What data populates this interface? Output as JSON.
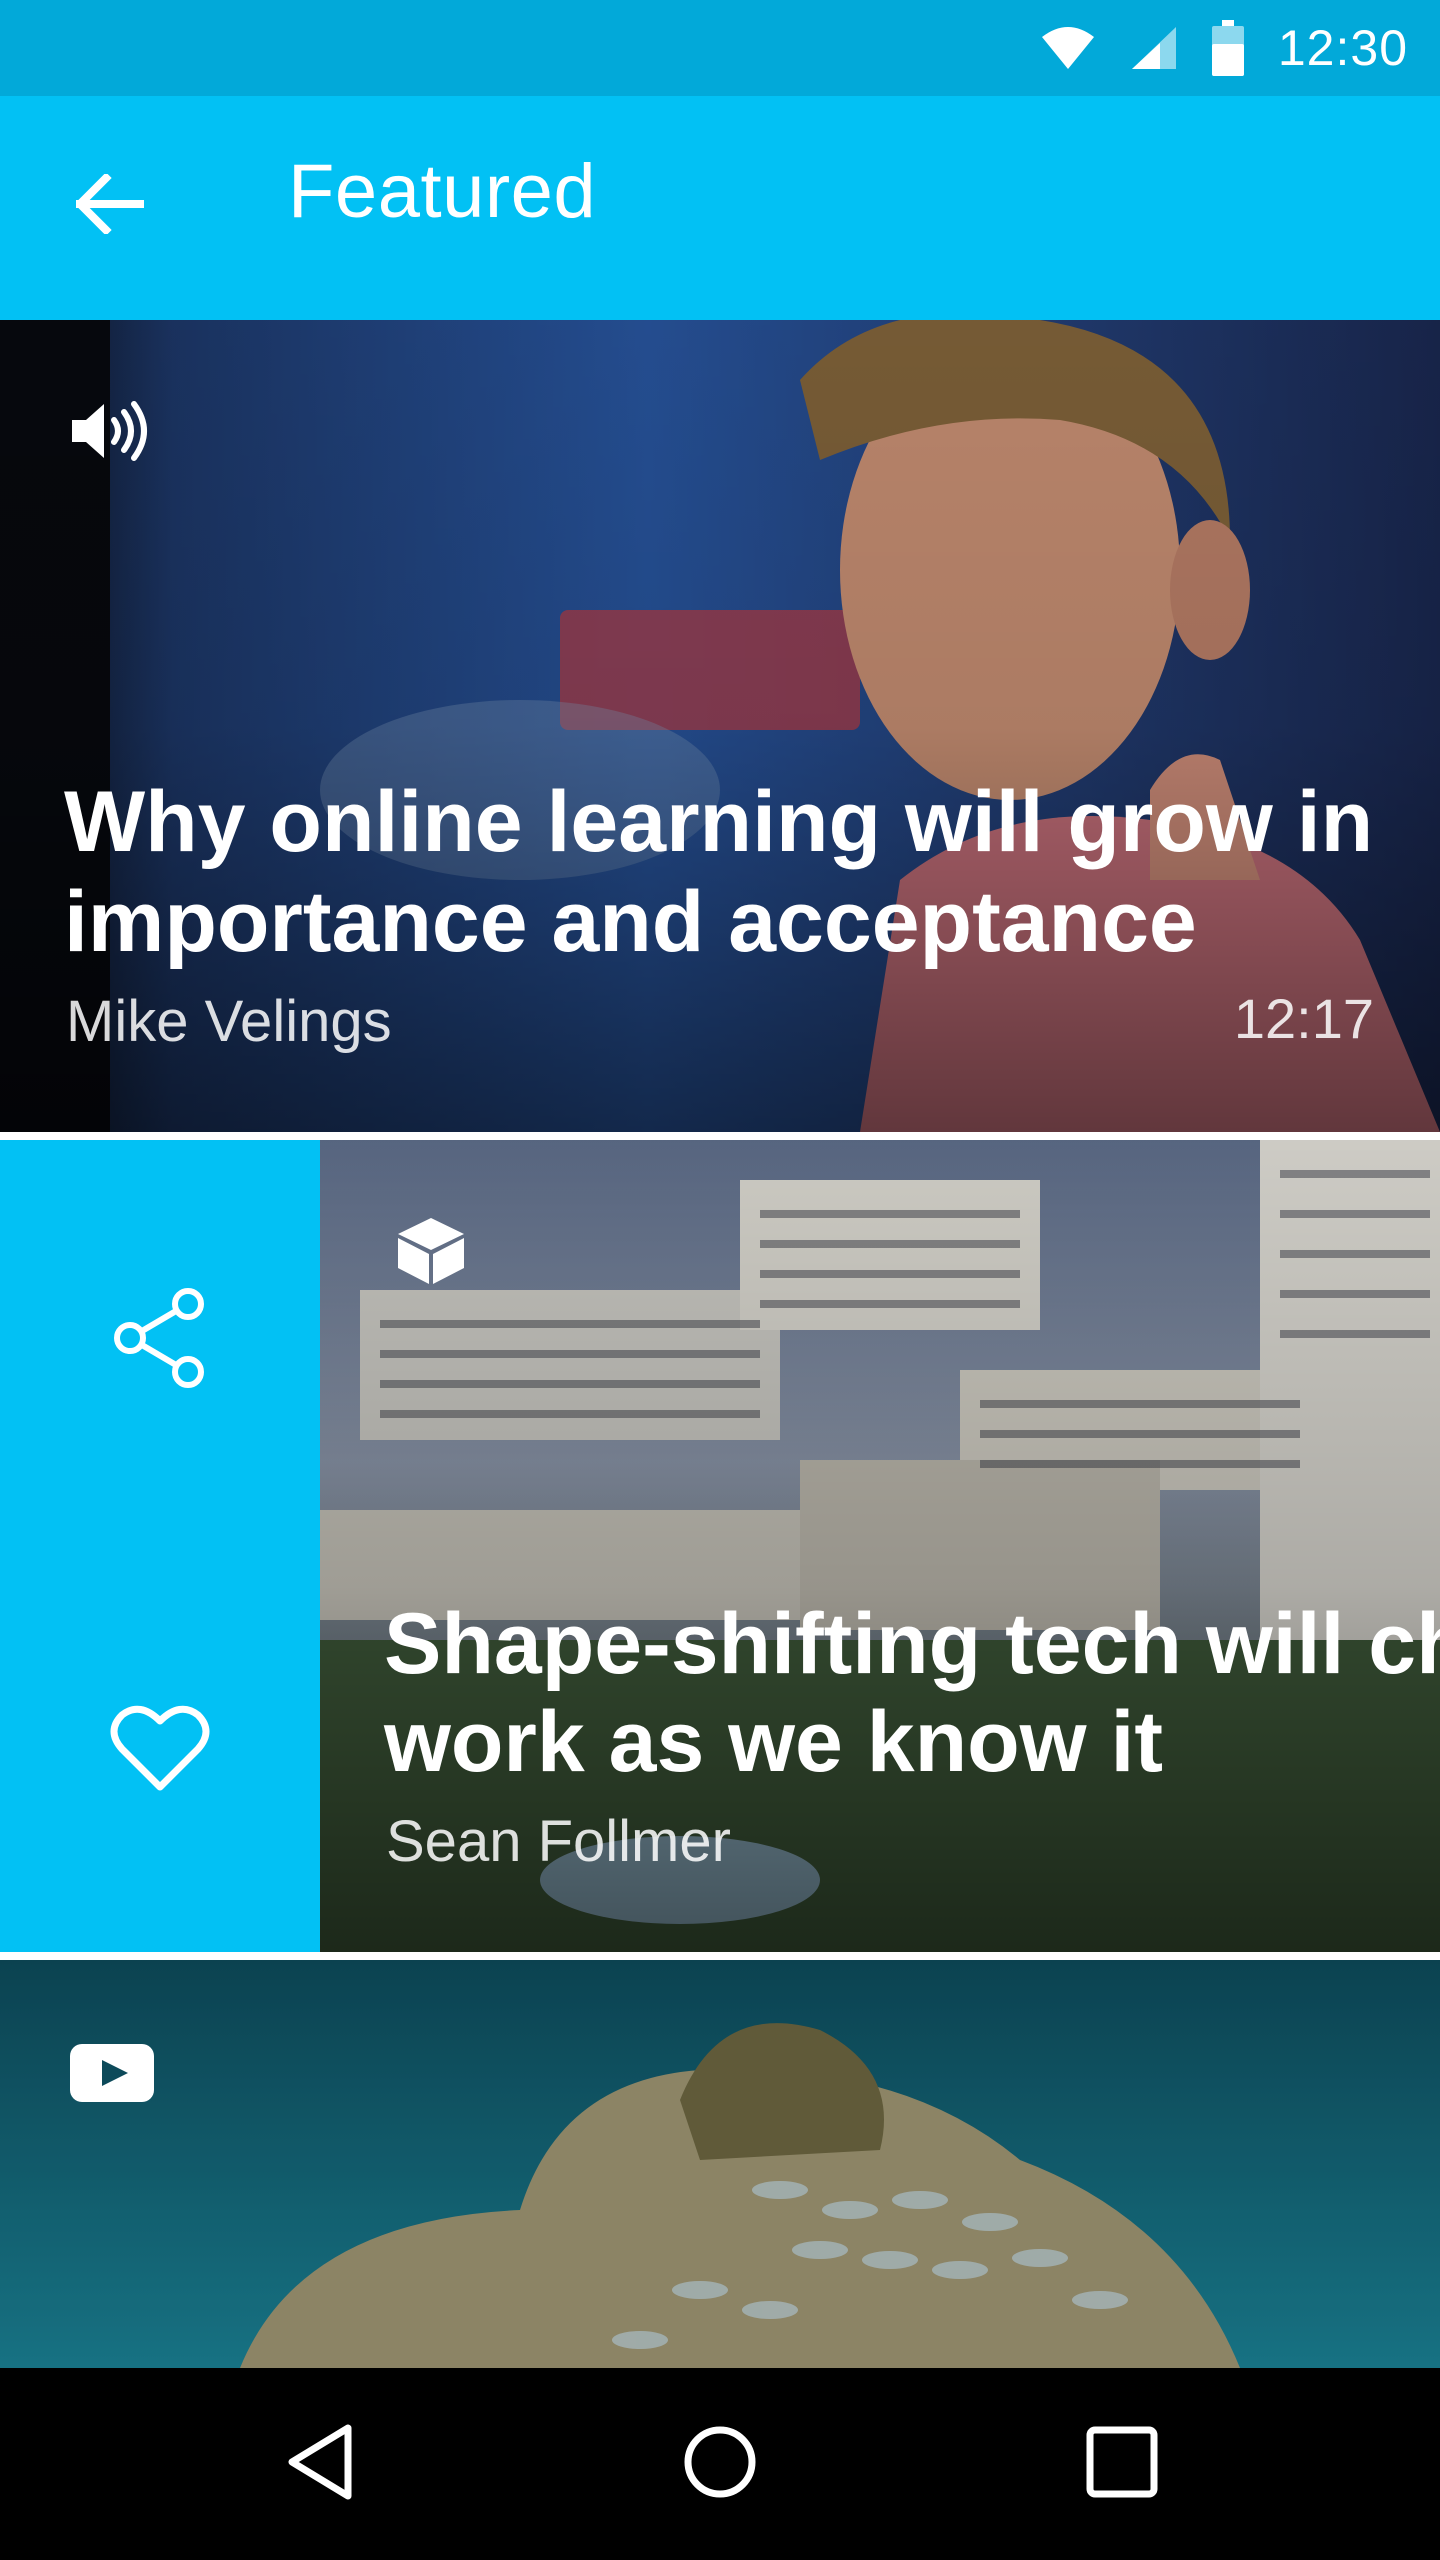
{
  "status_bar": {
    "time": "12:30",
    "icons": [
      "wifi-icon",
      "signal-icon",
      "battery-icon"
    ],
    "color": "#02a9d9"
  },
  "app_bar": {
    "title": "Featured",
    "back_icon": "arrow-left-icon",
    "color": "#02c1f4"
  },
  "cards": [
    {
      "type_icon": "volume-icon",
      "title_line1": "Why online learning will grow in",
      "title_line2": "importance and acceptance",
      "author": "Mike Velings",
      "duration": "12:17"
    },
    {
      "type_icon": "cube-icon",
      "title_line1": "Shape-shifting tech will cha",
      "title_line2": "work as we know it",
      "author": "Sean Follmer",
      "actions": [
        "share-icon",
        "heart-icon"
      ]
    },
    {
      "type_icon": "youtube-icon"
    }
  ],
  "nav_bar": {
    "buttons": [
      "back-triangle-icon",
      "home-circle-icon",
      "recents-square-icon"
    ]
  }
}
